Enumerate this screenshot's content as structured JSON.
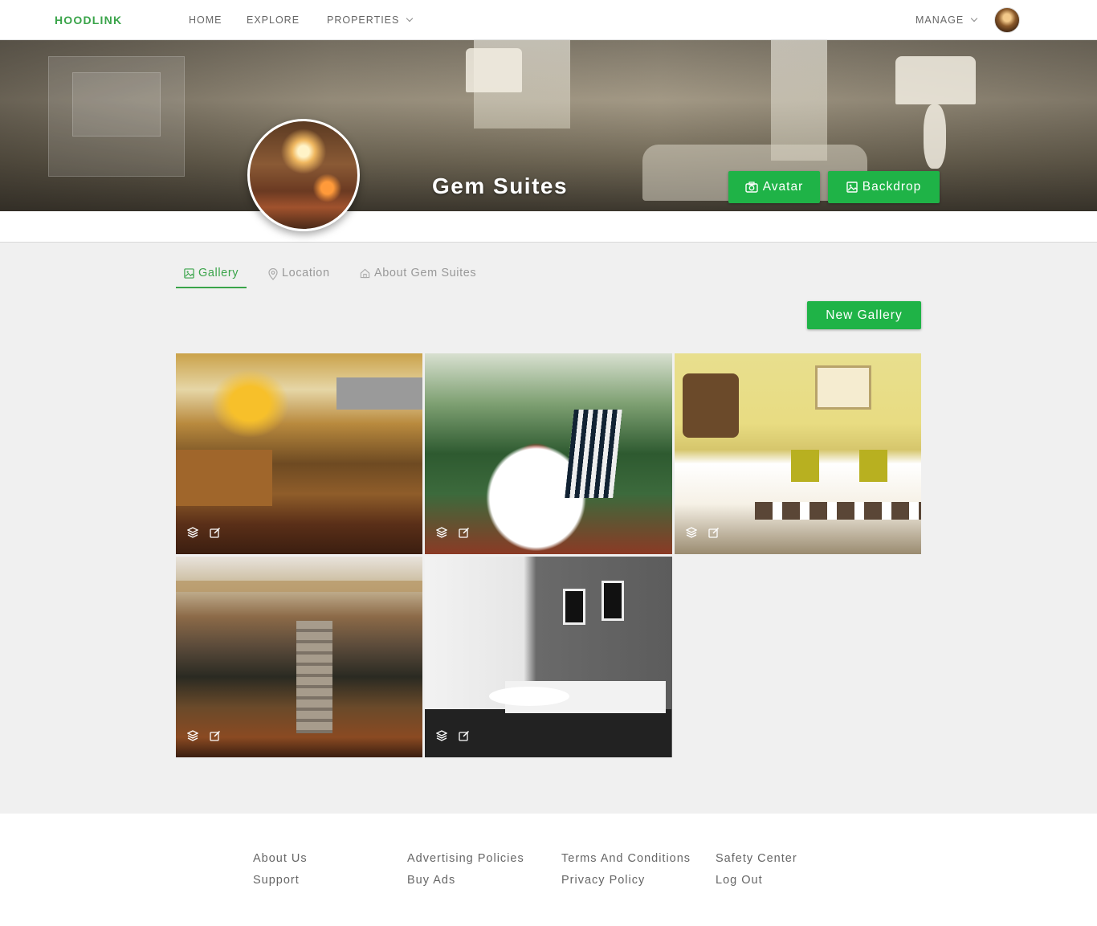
{
  "nav": {
    "brand": "HOODLINK",
    "links": [
      "HOME",
      "EXPLORE",
      "PROPERTIES"
    ],
    "manage": "MANAGE"
  },
  "hero": {
    "title": "Gem Suites",
    "avatar_button": "Avatar",
    "backdrop_button": "Backdrop"
  },
  "tabs": [
    {
      "label": "Gallery",
      "icon": "image-icon",
      "active": true
    },
    {
      "label": "Location",
      "icon": "map-pin-icon",
      "active": false
    },
    {
      "label": "About Gem Suites",
      "icon": "home-icon",
      "active": false
    }
  ],
  "gallery": {
    "new_button": "New Gallery",
    "items": [
      {
        "subject": "kitchen"
      },
      {
        "subject": "balcony"
      },
      {
        "subject": "bedroom"
      },
      {
        "subject": "living-room"
      },
      {
        "subject": "modern-lounge"
      }
    ]
  },
  "footer": {
    "col1": [
      "About Us",
      "Support"
    ],
    "col2": [
      "Advertising Policies",
      "Buy Ads"
    ],
    "col3": [
      "Terms And Conditions",
      "Privacy Policy"
    ],
    "col4": [
      "Safety Center",
      "Log Out"
    ]
  },
  "colors": {
    "accent": "#1fb347",
    "brand": "#3aa44a"
  }
}
